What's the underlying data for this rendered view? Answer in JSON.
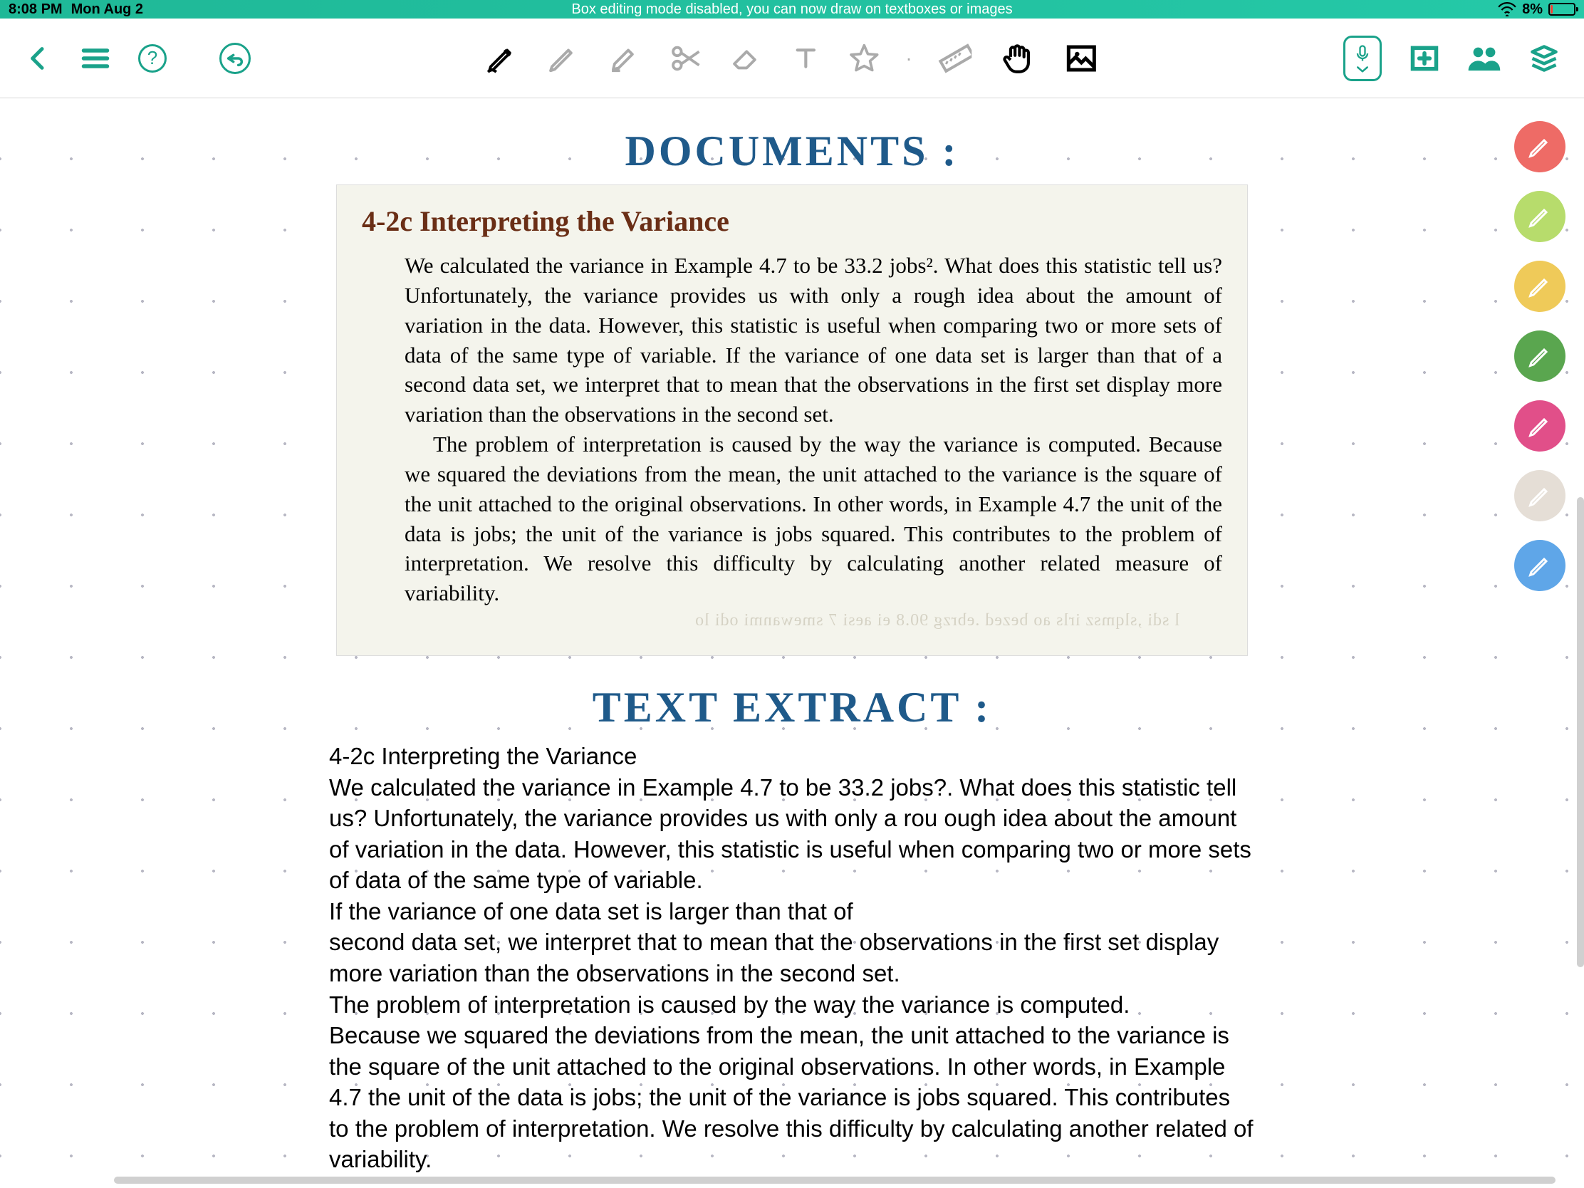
{
  "status": {
    "time": "8:08 PM",
    "date": "Mon Aug 2",
    "banner": "Box editing mode disabled, you can now draw on textboxes or images",
    "battery_pct": "8%"
  },
  "handwritten": {
    "documents_title": "DOCUMENTS :",
    "extract_title": "TEXT  EXTRACT :"
  },
  "document": {
    "heading": "4-2c  Interpreting the Variance",
    "para1": "We calculated the variance in Example 4.7 to be 33.2 jobs². What does this statistic tell us? Unfortunately, the variance provides us with only a rough idea about the amount of variation in the data. However, this statistic is useful when comparing two or more sets of data of the same type of variable. If the variance of one data set is larger than that of a second data set, we interpret that to mean that the observations in the first set display more variation than the observations in the second set.",
    "para2": "The problem of interpretation is caused by the way the variance is computed. Because we squared the deviations from the mean, the unit attached to the variance is the square of the unit attached to the original observations. In other words, in Example 4.7 the unit of the data is jobs; the unit of the variance is jobs squared. This contributes to the problem of interpretation. We resolve this difficulty by calculating another related measure of variability.",
    "ghost": "l sdi ,slqmsz irls ao bezed .ebrzg 90.8 ei aesi 7 smewanmi odi lo"
  },
  "extract": {
    "l1": "4-2c Interpreting the Variance",
    "l2": "We calculated the variance in Example 4.7 to be 33.2 jobs?. What does this statistic tell us? Unfortunately, the variance provides us with only a rou ough idea about the amount of variation in the data. However, this statistic is useful when comparing two or more sets of data of the same type of variable.",
    "l3": "If the variance of one data set is larger than that of",
    "l4": "second data set, we interpret that to mean that the observations in the first set display more variation than the observations in the second set.",
    "l5": "The problem of interpretation is caused by the way the variance is computed.",
    "l6": "Because we squared the deviations from the mean, the unit attached to the variance is the square of the unit attached to the original observations. In other words, in Example 4.7 the unit of the data is jobs; the unit of the variance is jobs squared. This contributes to the problem of interpretation. We resolve this difficulty by calculating another related of variability."
  },
  "toolbar": {
    "help": "?"
  },
  "pens": [
    {
      "color": "red"
    },
    {
      "color": "lime"
    },
    {
      "color": "yellow"
    },
    {
      "color": "green"
    },
    {
      "color": "pink"
    },
    {
      "color": "grey"
    },
    {
      "color": "blue"
    }
  ]
}
